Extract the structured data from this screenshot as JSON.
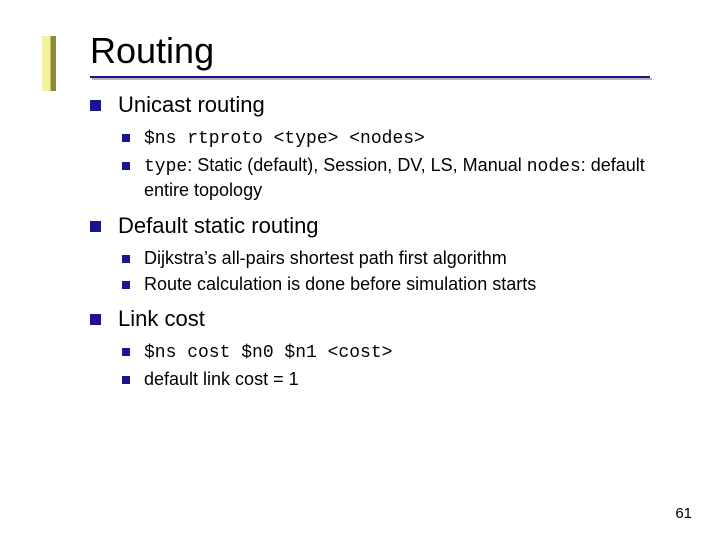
{
  "title": "Routing",
  "page_number": "61",
  "sections": [
    {
      "heading": "Unicast routing",
      "items": [
        {
          "code_full": "$ns rtproto <type> <nodes>"
        },
        {
          "code1": "type",
          "text1": ": Static (default), Session, DV, LS, Manual ",
          "code2": "nodes",
          "text2": ": default entire topology"
        }
      ]
    },
    {
      "heading": "Default static routing",
      "items": [
        {
          "text_full": "Dijkstra’s all-pairs shortest path first algorithm"
        },
        {
          "text_full": "Route calculation is done before simulation starts"
        }
      ]
    },
    {
      "heading": "Link cost",
      "items": [
        {
          "code_full": "$ns cost $n0 $n1 <cost>"
        },
        {
          "text_full": "default link cost = 1"
        }
      ]
    }
  ]
}
